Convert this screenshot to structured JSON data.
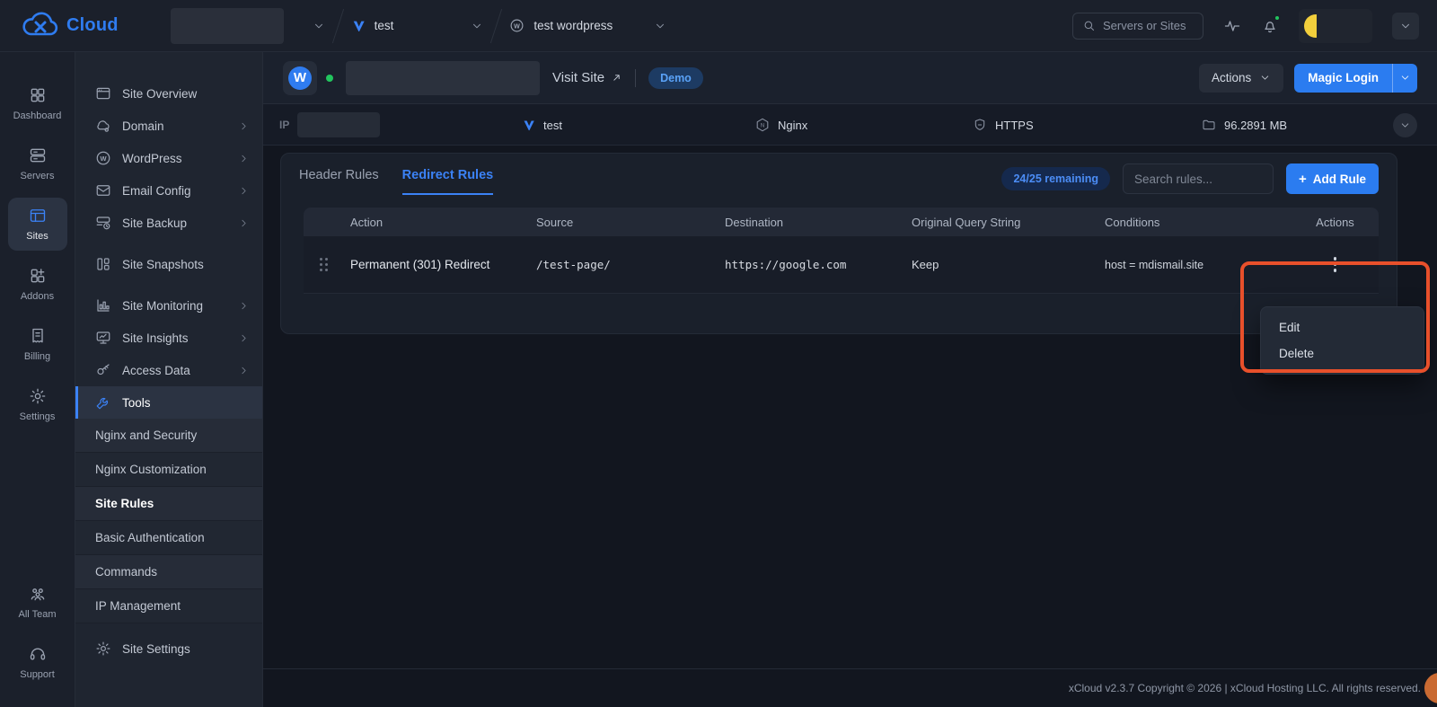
{
  "topbar": {
    "logo_text": "Cloud",
    "breadcrumb_site": {
      "label": "test"
    },
    "breadcrumb_app": {
      "label": "test wordpress"
    },
    "search_placeholder": "Servers or Sites"
  },
  "left_nav": {
    "items": [
      {
        "label": "Dashboard",
        "active": false
      },
      {
        "label": "Servers",
        "active": false
      },
      {
        "label": "Sites",
        "active": true
      },
      {
        "label": "Addons",
        "active": false
      },
      {
        "label": "Billing",
        "active": false
      },
      {
        "label": "Settings",
        "active": false
      }
    ],
    "bottom_items": [
      {
        "label": "All Team"
      },
      {
        "label": "Support"
      }
    ]
  },
  "site_menu": {
    "items": [
      {
        "label": "Site Overview",
        "expandable": false,
        "active": false
      },
      {
        "label": "Domain",
        "expandable": true,
        "active": false
      },
      {
        "label": "WordPress",
        "expandable": true,
        "active": false
      },
      {
        "label": "Email Config",
        "expandable": true,
        "active": false
      },
      {
        "label": "Site Backup",
        "expandable": true,
        "active": false
      },
      {
        "label": "Site Snapshots",
        "expandable": false,
        "active": false
      },
      {
        "label": "Site Monitoring",
        "expandable": true,
        "active": false
      },
      {
        "label": "Site Insights",
        "expandable": true,
        "active": false
      },
      {
        "label": "Access Data",
        "expandable": true,
        "active": false
      },
      {
        "label": "Tools",
        "expandable": false,
        "active": true
      }
    ],
    "tools_submenu": [
      {
        "label": "Nginx and Security",
        "active": false
      },
      {
        "label": "Nginx Customization",
        "active": false
      },
      {
        "label": "Site Rules",
        "active": true
      },
      {
        "label": "Basic Authentication",
        "active": false
      },
      {
        "label": "Commands",
        "active": false
      },
      {
        "label": "IP Management",
        "active": false
      }
    ],
    "settings_item": {
      "label": "Site Settings"
    }
  },
  "site_header": {
    "visit_site": "Visit Site",
    "demo_badge": "Demo",
    "actions_button": "Actions",
    "magic_login_button": "Magic Login"
  },
  "info_bar": {
    "ip_label": "IP",
    "provider": "test",
    "web_server": "Nginx",
    "ssl": "HTTPS",
    "disk_usage": "96.2891 MB"
  },
  "rules_panel": {
    "tabs": [
      {
        "label": "Header Rules",
        "active": false
      },
      {
        "label": "Redirect Rules",
        "active": true
      }
    ],
    "remaining_badge": "24/25 remaining",
    "search_placeholder": "Search rules...",
    "add_rule_button": "Add Rule",
    "table": {
      "headers": [
        "Action",
        "Source",
        "Destination",
        "Original Query String",
        "Conditions",
        "Actions"
      ],
      "rows": [
        {
          "action": "Permanent (301) Redirect",
          "source": "/test-page/",
          "destination": "https://google.com",
          "original_query_string": "Keep",
          "conditions": "host = mdismail.site"
        }
      ]
    },
    "row_menu": {
      "items": [
        {
          "label": "Edit"
        },
        {
          "label": "Delete"
        }
      ]
    }
  },
  "footer": {
    "copyright": "xCloud v2.3.7 Copyright © 2026 | xCloud Hosting LLC. All rights reserved."
  },
  "colors": {
    "accent_blue": "#2f7cf0",
    "annotation_orange": "#e8502b",
    "status_green": "#22c55e",
    "avatar_yellow": "#f2cf3c"
  }
}
